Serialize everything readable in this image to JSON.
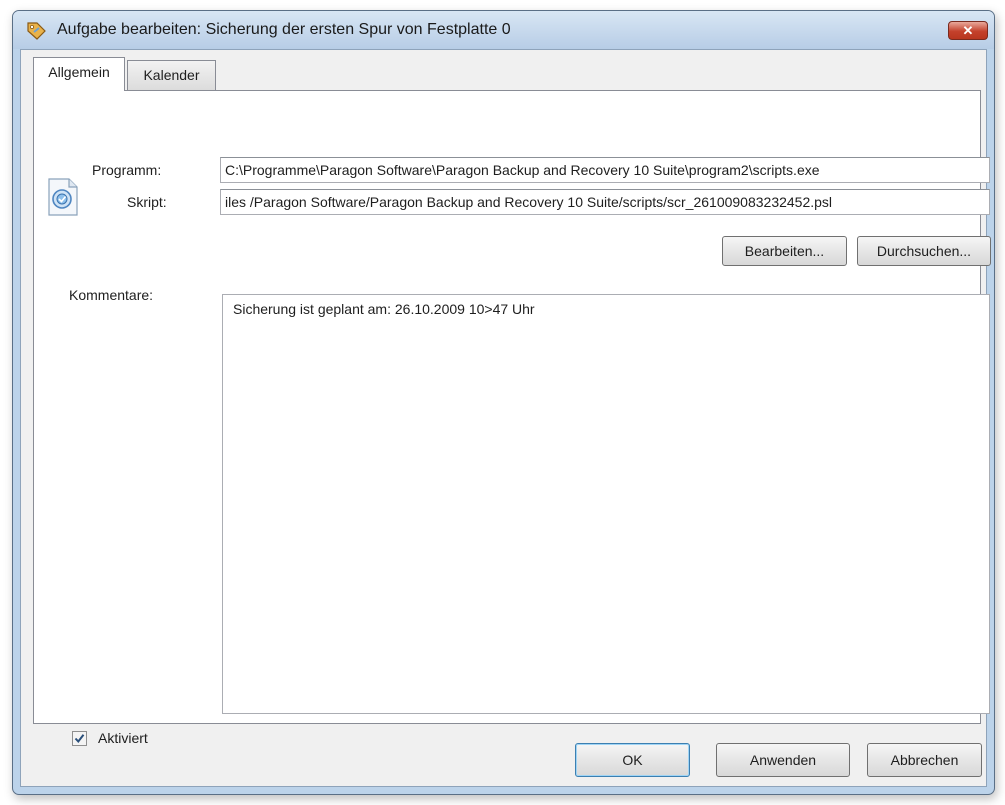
{
  "window": {
    "title": "Aufgabe bearbeiten: Sicherung der ersten Spur von Festplatte 0",
    "close_label": "✕"
  },
  "tabs": [
    {
      "label": "Allgemein",
      "active": true
    },
    {
      "label": "Kalender",
      "active": false
    }
  ],
  "general": {
    "program_label": "Programm:",
    "program_value": "C:\\Programme\\Paragon Software\\Paragon Backup and Recovery 10 Suite\\program2\\scripts.exe",
    "script_label": "Skript:",
    "script_value": "iles /Paragon Software/Paragon Backup and Recovery 10 Suite/scripts/scr_261009083232452.psl",
    "edit_button": "Bearbeiten...",
    "browse_button": "Durchsuchen...",
    "comments_label": "Kommentare:",
    "comments_value": "Sicherung ist geplant am: 26.10.2009 10>47 Uhr",
    "enabled_label": "Aktiviert",
    "enabled_checked": true
  },
  "footer": {
    "ok_button": "OK",
    "apply_button": "Anwenden",
    "cancel_button": "Abbrechen"
  },
  "icons": {
    "app": "tag-icon",
    "script": "script-file-icon",
    "check": "checkmark-icon"
  },
  "colors": {
    "title_bar": "#bcd3ea",
    "close_button": "#c4412c",
    "default_button_border": "#3c7fb1"
  }
}
